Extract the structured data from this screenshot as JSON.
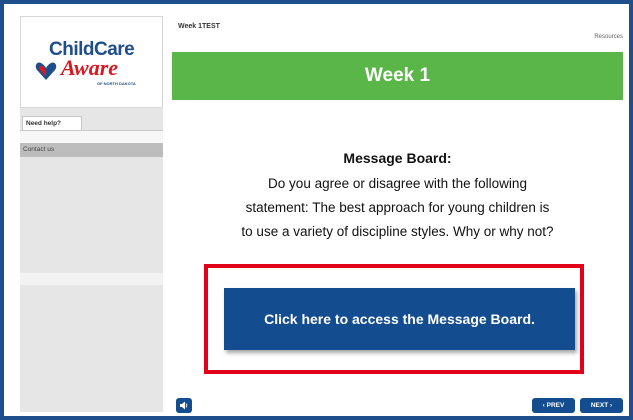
{
  "logo": {
    "top_text": "ChildCare",
    "script_text": "Aware",
    "sub_text": "OF NORTH DAKOTA"
  },
  "sidebar": {
    "help_tab": "Need help?",
    "contact_label": "Contact us"
  },
  "header": {
    "week_label": "Week 1TEST",
    "resources": "Resources",
    "banner_title": "Week 1"
  },
  "content": {
    "heading": "Message Board:",
    "line1": "Do you agree or disagree with the following",
    "line2": "statement: The best approach for young children is",
    "line3": "to use a variety of discipline styles. Why or why not?"
  },
  "cta": {
    "label": "Click here to access the Message Board."
  },
  "nav": {
    "prev_label": "‹ PREV",
    "next_label": "NEXT ›"
  },
  "colors": {
    "banner": "#5bb64a",
    "button": "#144d8f",
    "highlight": "#e3001b",
    "frame": "#1f4e8c"
  },
  "icons": {
    "audio": "speaker-icon",
    "logo_heart": "heart-icon"
  }
}
